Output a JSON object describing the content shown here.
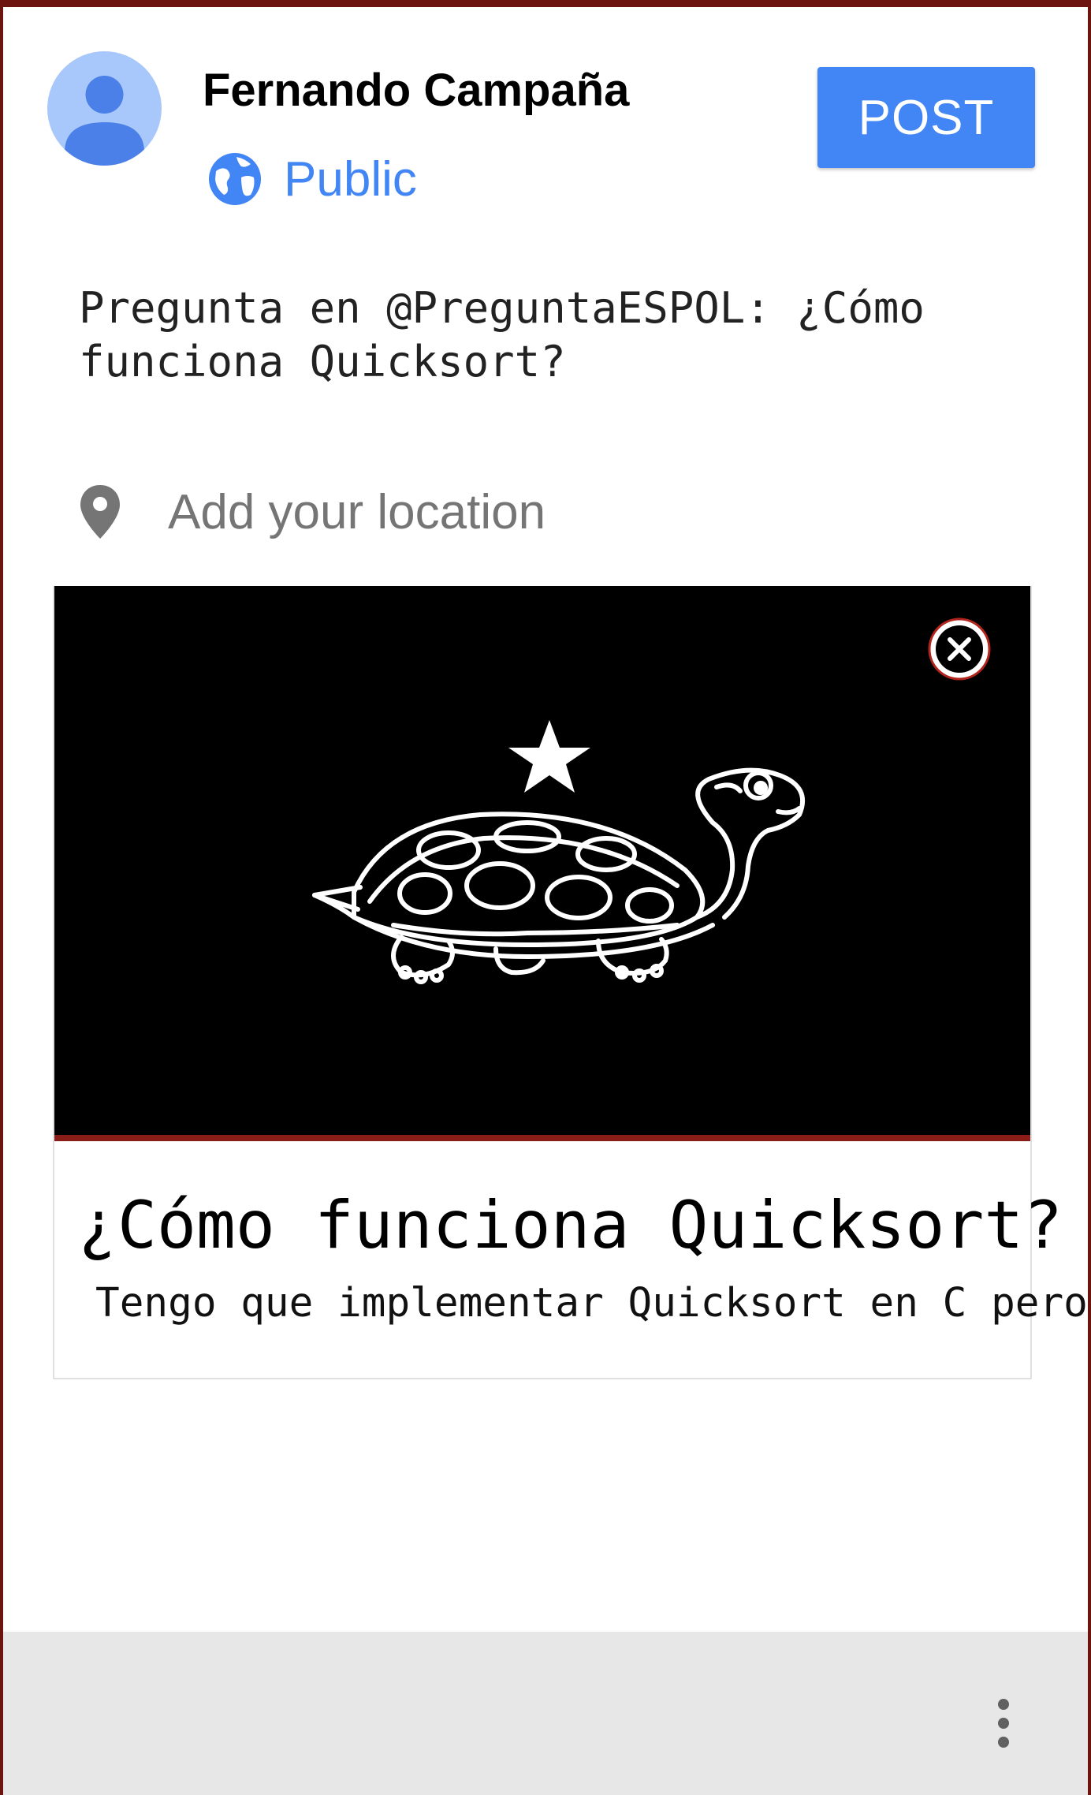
{
  "header": {
    "user_name": "Fernando Campaña",
    "visibility_label": "Public",
    "post_label": "POST",
    "accent_color": "#4285f4"
  },
  "composer": {
    "message": "Pregunta en @PreguntaESPOL: ¿Cómo\nfunciona Quicksort?"
  },
  "location": {
    "placeholder": "Add your location",
    "icon": "location-pin-icon"
  },
  "link_preview": {
    "image": "turtle-logo",
    "title": "¿Cómo funciona Quicksort?",
    "description": "Tengo que implementar Quicksort en C pero...",
    "remove_icon": "close-circle-icon"
  },
  "footer": {
    "menu_icon": "more-vert-icon"
  }
}
